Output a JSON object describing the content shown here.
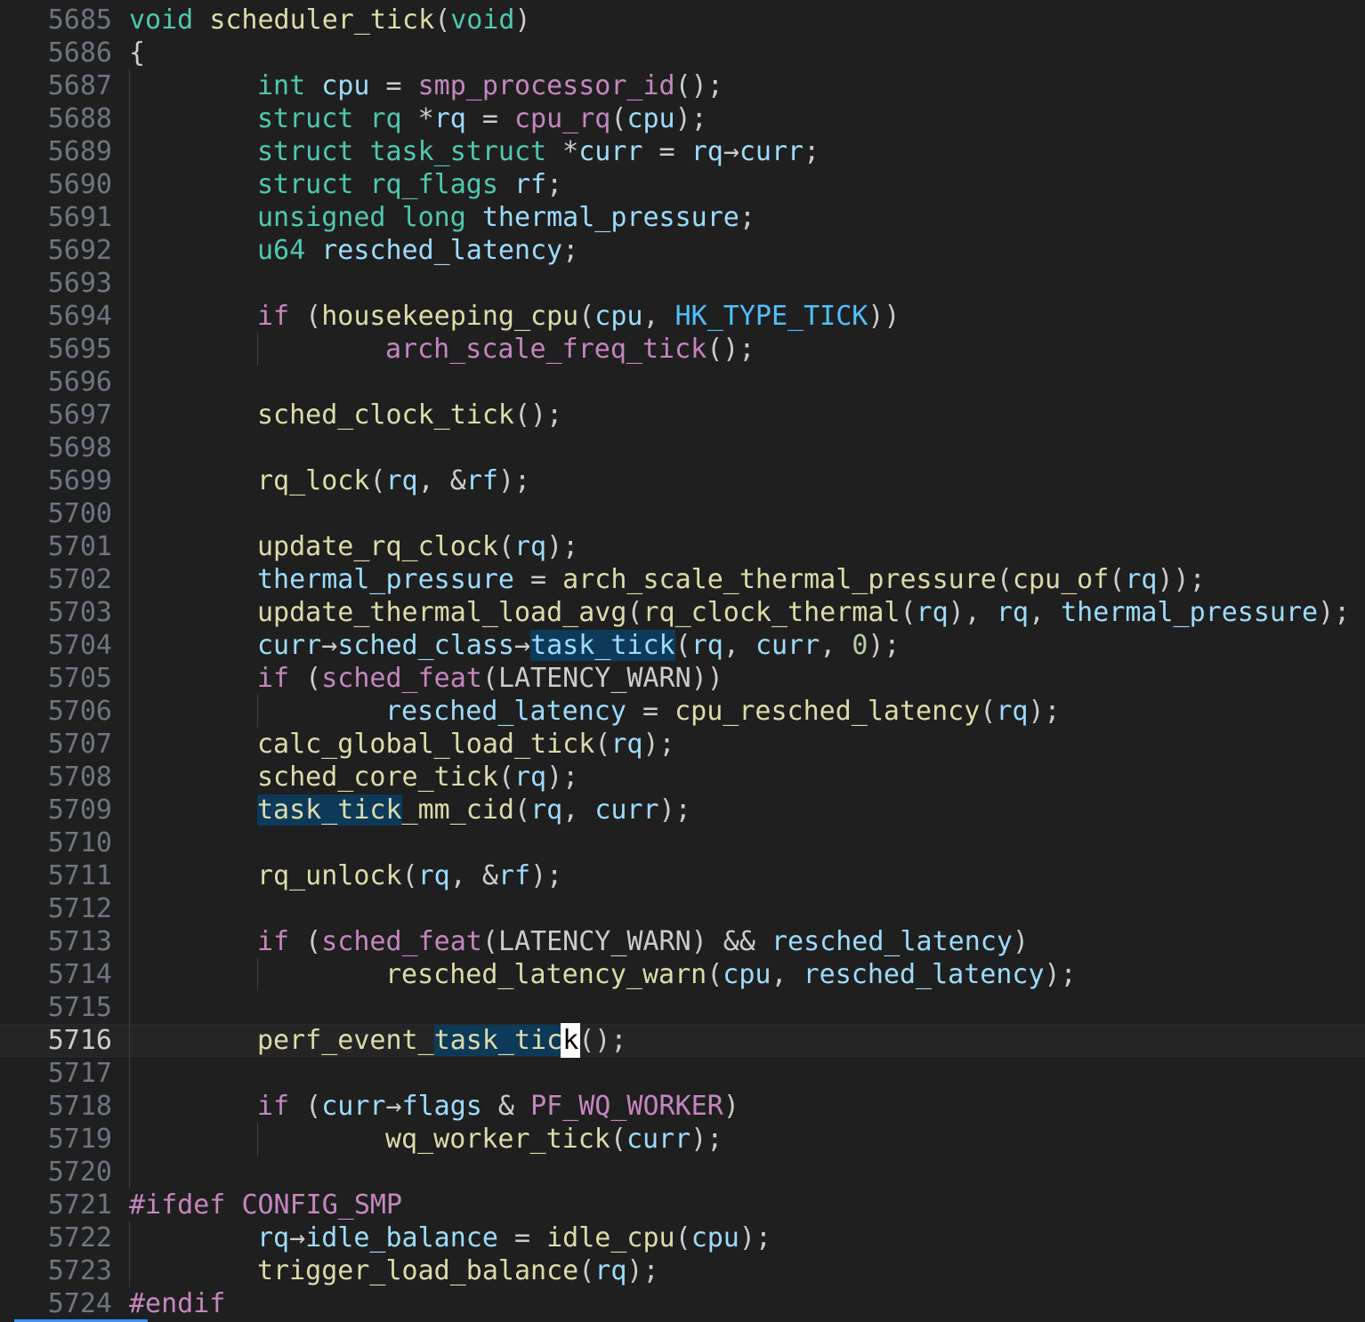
{
  "colors": {
    "background": "#1f1f1f",
    "line_number": "#6e7681",
    "keyword": "#569cd6",
    "type": "#4ec9b0",
    "function": "#dcdcaa",
    "variable": "#9cdcfe",
    "macro": "#c586c0",
    "constant": "#4fc1ff",
    "number": "#b5cea8",
    "punct": "#cccccc",
    "word_highlight": "#0e3a5a"
  },
  "editor": {
    "current_line": "5716",
    "lines": [
      {
        "n": "5685",
        "indent": 0,
        "tokens": [
          {
            "t": "void",
            "c": "type"
          },
          {
            "t": " ",
            "c": "punct"
          },
          {
            "t": "scheduler_tick",
            "c": "function"
          },
          {
            "t": "(",
            "c": "punct"
          },
          {
            "t": "void",
            "c": "type"
          },
          {
            "t": ")",
            "c": "punct"
          }
        ]
      },
      {
        "n": "5686",
        "indent": 0,
        "tokens": [
          {
            "t": "{",
            "c": "punct"
          }
        ]
      },
      {
        "n": "5687",
        "indent": 1,
        "tokens": [
          {
            "t": "int",
            "c": "type"
          },
          {
            "t": " ",
            "c": "punct"
          },
          {
            "t": "cpu",
            "c": "variable"
          },
          {
            "t": " = ",
            "c": "punct"
          },
          {
            "t": "smp_processor_id",
            "c": "macro"
          },
          {
            "t": "();",
            "c": "punct"
          }
        ]
      },
      {
        "n": "5688",
        "indent": 1,
        "tokens": [
          {
            "t": "struct",
            "c": "type"
          },
          {
            "t": " ",
            "c": "punct"
          },
          {
            "t": "rq",
            "c": "type"
          },
          {
            "t": " *",
            "c": "punct"
          },
          {
            "t": "rq",
            "c": "variable"
          },
          {
            "t": " = ",
            "c": "punct"
          },
          {
            "t": "cpu_rq",
            "c": "macro"
          },
          {
            "t": "(",
            "c": "punct"
          },
          {
            "t": "cpu",
            "c": "variable"
          },
          {
            "t": ");",
            "c": "punct"
          }
        ]
      },
      {
        "n": "5689",
        "indent": 1,
        "tokens": [
          {
            "t": "struct",
            "c": "type"
          },
          {
            "t": " ",
            "c": "punct"
          },
          {
            "t": "task_struct",
            "c": "type"
          },
          {
            "t": " *",
            "c": "punct"
          },
          {
            "t": "curr",
            "c": "variable"
          },
          {
            "t": " = ",
            "c": "punct"
          },
          {
            "t": "rq",
            "c": "variable"
          },
          {
            "t": "→",
            "c": "punct"
          },
          {
            "t": "curr",
            "c": "variable"
          },
          {
            "t": ";",
            "c": "punct"
          }
        ]
      },
      {
        "n": "5690",
        "indent": 1,
        "tokens": [
          {
            "t": "struct",
            "c": "type"
          },
          {
            "t": " ",
            "c": "punct"
          },
          {
            "t": "rq_flags",
            "c": "type"
          },
          {
            "t": " ",
            "c": "punct"
          },
          {
            "t": "rf",
            "c": "variable"
          },
          {
            "t": ";",
            "c": "punct"
          }
        ]
      },
      {
        "n": "5691",
        "indent": 1,
        "tokens": [
          {
            "t": "unsigned",
            "c": "type"
          },
          {
            "t": " ",
            "c": "punct"
          },
          {
            "t": "long",
            "c": "type"
          },
          {
            "t": " ",
            "c": "punct"
          },
          {
            "t": "thermal_pressure",
            "c": "variable"
          },
          {
            "t": ";",
            "c": "punct"
          }
        ]
      },
      {
        "n": "5692",
        "indent": 1,
        "tokens": [
          {
            "t": "u64",
            "c": "type"
          },
          {
            "t": " ",
            "c": "punct"
          },
          {
            "t": "resched_latency",
            "c": "variable"
          },
          {
            "t": ";",
            "c": "punct"
          }
        ]
      },
      {
        "n": "5693",
        "indent": 1,
        "tokens": []
      },
      {
        "n": "5694",
        "indent": 1,
        "tokens": [
          {
            "t": "if",
            "c": "macro"
          },
          {
            "t": " (",
            "c": "punct"
          },
          {
            "t": "housekeeping_cpu",
            "c": "function"
          },
          {
            "t": "(",
            "c": "punct"
          },
          {
            "t": "cpu",
            "c": "variable"
          },
          {
            "t": ", ",
            "c": "punct"
          },
          {
            "t": "HK_TYPE_TICK",
            "c": "constant"
          },
          {
            "t": "))",
            "c": "punct"
          }
        ]
      },
      {
        "n": "5695",
        "indent": 2,
        "tokens": [
          {
            "t": "arch_scale_freq_tick",
            "c": "macro"
          },
          {
            "t": "();",
            "c": "punct"
          }
        ]
      },
      {
        "n": "5696",
        "indent": 1,
        "tokens": []
      },
      {
        "n": "5697",
        "indent": 1,
        "tokens": [
          {
            "t": "sched_clock_tick",
            "c": "function"
          },
          {
            "t": "();",
            "c": "punct"
          }
        ]
      },
      {
        "n": "5698",
        "indent": 1,
        "tokens": []
      },
      {
        "n": "5699",
        "indent": 1,
        "tokens": [
          {
            "t": "rq_lock",
            "c": "function"
          },
          {
            "t": "(",
            "c": "punct"
          },
          {
            "t": "rq",
            "c": "variable"
          },
          {
            "t": ", &",
            "c": "punct"
          },
          {
            "t": "rf",
            "c": "variable"
          },
          {
            "t": ");",
            "c": "punct"
          }
        ]
      },
      {
        "n": "5700",
        "indent": 1,
        "tokens": []
      },
      {
        "n": "5701",
        "indent": 1,
        "tokens": [
          {
            "t": "update_rq_clock",
            "c": "function"
          },
          {
            "t": "(",
            "c": "punct"
          },
          {
            "t": "rq",
            "c": "variable"
          },
          {
            "t": ");",
            "c": "punct"
          }
        ]
      },
      {
        "n": "5702",
        "indent": 1,
        "tokens": [
          {
            "t": "thermal_pressure",
            "c": "variable"
          },
          {
            "t": " = ",
            "c": "punct"
          },
          {
            "t": "arch_scale_thermal_pressure",
            "c": "function"
          },
          {
            "t": "(",
            "c": "punct"
          },
          {
            "t": "cpu_of",
            "c": "function"
          },
          {
            "t": "(",
            "c": "punct"
          },
          {
            "t": "rq",
            "c": "variable"
          },
          {
            "t": "));",
            "c": "punct"
          }
        ]
      },
      {
        "n": "5703",
        "indent": 1,
        "tokens": [
          {
            "t": "update_thermal_load_avg",
            "c": "function"
          },
          {
            "t": "(",
            "c": "punct"
          },
          {
            "t": "rq_clock_thermal",
            "c": "function"
          },
          {
            "t": "(",
            "c": "punct"
          },
          {
            "t": "rq",
            "c": "variable"
          },
          {
            "t": "), ",
            "c": "punct"
          },
          {
            "t": "rq",
            "c": "variable"
          },
          {
            "t": ", ",
            "c": "punct"
          },
          {
            "t": "thermal_pressure",
            "c": "variable"
          },
          {
            "t": ");",
            "c": "punct"
          }
        ]
      },
      {
        "n": "5704",
        "indent": 1,
        "tokens": [
          {
            "t": "curr",
            "c": "variable"
          },
          {
            "t": "→",
            "c": "punct"
          },
          {
            "t": "sched_class",
            "c": "variable"
          },
          {
            "t": "→",
            "c": "punct"
          },
          {
            "t": "task_tick",
            "c": "variable",
            "hl": true
          },
          {
            "t": "(",
            "c": "punct"
          },
          {
            "t": "rq",
            "c": "variable"
          },
          {
            "t": ", ",
            "c": "punct"
          },
          {
            "t": "curr",
            "c": "variable"
          },
          {
            "t": ", ",
            "c": "punct"
          },
          {
            "t": "0",
            "c": "number"
          },
          {
            "t": ");",
            "c": "punct"
          }
        ]
      },
      {
        "n": "5705",
        "indent": 1,
        "tokens": [
          {
            "t": "if",
            "c": "macro"
          },
          {
            "t": " (",
            "c": "punct"
          },
          {
            "t": "sched_feat",
            "c": "macro"
          },
          {
            "t": "(",
            "c": "punct"
          },
          {
            "t": "LATENCY_WARN",
            "c": "punct"
          },
          {
            "t": "))",
            "c": "punct"
          }
        ]
      },
      {
        "n": "5706",
        "indent": 2,
        "tokens": [
          {
            "t": "resched_latency",
            "c": "variable"
          },
          {
            "t": " = ",
            "c": "punct"
          },
          {
            "t": "cpu_resched_latency",
            "c": "function"
          },
          {
            "t": "(",
            "c": "punct"
          },
          {
            "t": "rq",
            "c": "variable"
          },
          {
            "t": ");",
            "c": "punct"
          }
        ]
      },
      {
        "n": "5707",
        "indent": 1,
        "tokens": [
          {
            "t": "calc_global_load_tick",
            "c": "function"
          },
          {
            "t": "(",
            "c": "punct"
          },
          {
            "t": "rq",
            "c": "variable"
          },
          {
            "t": ");",
            "c": "punct"
          }
        ]
      },
      {
        "n": "5708",
        "indent": 1,
        "tokens": [
          {
            "t": "sched_core_tick",
            "c": "function"
          },
          {
            "t": "(",
            "c": "punct"
          },
          {
            "t": "rq",
            "c": "variable"
          },
          {
            "t": ");",
            "c": "punct"
          }
        ]
      },
      {
        "n": "5709",
        "indent": 1,
        "tokens": [
          {
            "t": "task_tick",
            "c": "function",
            "hl": true
          },
          {
            "t": "_mm_cid",
            "c": "function"
          },
          {
            "t": "(",
            "c": "punct"
          },
          {
            "t": "rq",
            "c": "variable"
          },
          {
            "t": ", ",
            "c": "punct"
          },
          {
            "t": "curr",
            "c": "variable"
          },
          {
            "t": ");",
            "c": "punct"
          }
        ]
      },
      {
        "n": "5710",
        "indent": 1,
        "tokens": []
      },
      {
        "n": "5711",
        "indent": 1,
        "tokens": [
          {
            "t": "rq_unlock",
            "c": "function"
          },
          {
            "t": "(",
            "c": "punct"
          },
          {
            "t": "rq",
            "c": "variable"
          },
          {
            "t": ", &",
            "c": "punct"
          },
          {
            "t": "rf",
            "c": "variable"
          },
          {
            "t": ");",
            "c": "punct"
          }
        ]
      },
      {
        "n": "5712",
        "indent": 1,
        "tokens": []
      },
      {
        "n": "5713",
        "indent": 1,
        "tokens": [
          {
            "t": "if",
            "c": "macro"
          },
          {
            "t": " (",
            "c": "punct"
          },
          {
            "t": "sched_feat",
            "c": "macro"
          },
          {
            "t": "(",
            "c": "punct"
          },
          {
            "t": "LATENCY_WARN",
            "c": "punct"
          },
          {
            "t": ") && ",
            "c": "punct"
          },
          {
            "t": "resched_latency",
            "c": "variable"
          },
          {
            "t": ")",
            "c": "punct"
          }
        ]
      },
      {
        "n": "5714",
        "indent": 2,
        "tokens": [
          {
            "t": "resched_latency_warn",
            "c": "function"
          },
          {
            "t": "(",
            "c": "punct"
          },
          {
            "t": "cpu",
            "c": "variable"
          },
          {
            "t": ", ",
            "c": "punct"
          },
          {
            "t": "resched_latency",
            "c": "variable"
          },
          {
            "t": ");",
            "c": "punct"
          }
        ]
      },
      {
        "n": "5715",
        "indent": 1,
        "tokens": []
      },
      {
        "n": "5716",
        "indent": 1,
        "tokens": [
          {
            "t": "perf_event_",
            "c": "function"
          },
          {
            "t": "task_tic",
            "c": "function",
            "hl": true
          },
          {
            "t": "k",
            "c": "function",
            "cursor": true
          },
          {
            "t": "();",
            "c": "punct"
          }
        ]
      },
      {
        "n": "5717",
        "indent": 1,
        "tokens": []
      },
      {
        "n": "5718",
        "indent": 1,
        "tokens": [
          {
            "t": "if",
            "c": "macro"
          },
          {
            "t": " (",
            "c": "punct"
          },
          {
            "t": "curr",
            "c": "variable"
          },
          {
            "t": "→",
            "c": "punct"
          },
          {
            "t": "flags",
            "c": "variable"
          },
          {
            "t": " & ",
            "c": "punct"
          },
          {
            "t": "PF_WQ_WORKER",
            "c": "macro"
          },
          {
            "t": ")",
            "c": "punct"
          }
        ]
      },
      {
        "n": "5719",
        "indent": 2,
        "tokens": [
          {
            "t": "wq_worker_tick",
            "c": "function"
          },
          {
            "t": "(",
            "c": "punct"
          },
          {
            "t": "curr",
            "c": "variable"
          },
          {
            "t": ");",
            "c": "punct"
          }
        ]
      },
      {
        "n": "5720",
        "indent": 1,
        "tokens": []
      },
      {
        "n": "5721",
        "indent": 0,
        "tokens": [
          {
            "t": "#ifdef",
            "c": "macro"
          },
          {
            "t": " ",
            "c": "punct"
          },
          {
            "t": "CONFIG_SMP",
            "c": "macro"
          }
        ]
      },
      {
        "n": "5722",
        "indent": 1,
        "tokens": [
          {
            "t": "rq",
            "c": "variable"
          },
          {
            "t": "→",
            "c": "punct"
          },
          {
            "t": "idle_balance",
            "c": "variable"
          },
          {
            "t": " = ",
            "c": "punct"
          },
          {
            "t": "idle_cpu",
            "c": "function"
          },
          {
            "t": "(",
            "c": "punct"
          },
          {
            "t": "cpu",
            "c": "variable"
          },
          {
            "t": ");",
            "c": "punct"
          }
        ]
      },
      {
        "n": "5723",
        "indent": 1,
        "tokens": [
          {
            "t": "trigger_load_balance",
            "c": "function"
          },
          {
            "t": "(",
            "c": "punct"
          },
          {
            "t": "rq",
            "c": "variable"
          },
          {
            "t": ");",
            "c": "punct"
          }
        ]
      },
      {
        "n": "5724",
        "indent": 0,
        "tokens": [
          {
            "t": "#endif",
            "c": "macro"
          }
        ]
      }
    ]
  }
}
